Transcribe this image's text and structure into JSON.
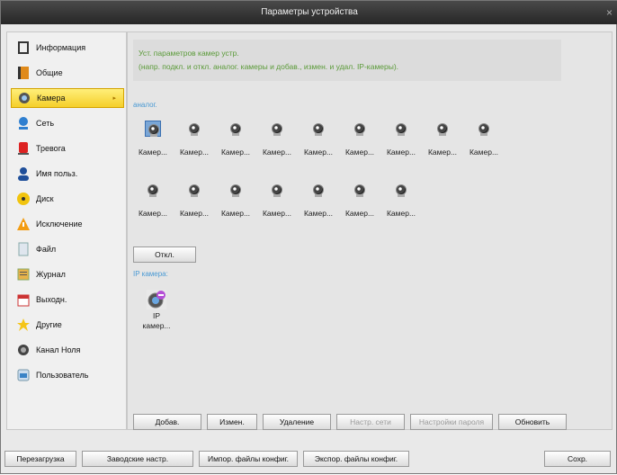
{
  "window": {
    "title": "Параметры устройства"
  },
  "sidebar": {
    "items": [
      {
        "label": "Информация",
        "icon": "info-icon"
      },
      {
        "label": "Общие",
        "icon": "book-icon"
      },
      {
        "label": "Камера",
        "icon": "camera-icon",
        "active": true
      },
      {
        "label": "Сеть",
        "icon": "network-icon"
      },
      {
        "label": "Тревога",
        "icon": "alarm-icon"
      },
      {
        "label": "Имя польз.",
        "icon": "user-icon"
      },
      {
        "label": "Диск",
        "icon": "disk-icon"
      },
      {
        "label": "Исключение",
        "icon": "warning-icon"
      },
      {
        "label": "Файл",
        "icon": "file-icon"
      },
      {
        "label": "Журнал",
        "icon": "log-icon"
      },
      {
        "label": "Выходн.",
        "icon": "holiday-icon"
      },
      {
        "label": "Другие",
        "icon": "star-icon"
      },
      {
        "label": "Канал Ноля",
        "icon": "zero-channel-icon"
      },
      {
        "label": "Пользователь",
        "icon": "custom-user-icon"
      }
    ]
  },
  "info": {
    "line1": "Уст. параметров камер устр.",
    "line2": "(напр. подкл. и откл. аналог. камеры и добав., измен. и удал. IP-камеры)."
  },
  "analog": {
    "label": "аналог.",
    "row1": [
      "Камер...",
      "Камер...",
      "Камер...",
      "Камер...",
      "Камер...",
      "Камер...",
      "Камер...",
      "Камер...",
      "Камер..."
    ],
    "row2": [
      "Камер...",
      "Камер...",
      "Камер...",
      "Камер...",
      "Камер...",
      "Камер...",
      "Камер..."
    ],
    "off_button": "Откл."
  },
  "ip": {
    "label": "IP камера:",
    "camera_label_line1": "IP",
    "camera_label_line2": "камер..."
  },
  "actions": {
    "add": "Добав.",
    "edit": "Измен.",
    "delete": "Удаление",
    "network": "Настр. сети",
    "password": "Настройки пароля",
    "refresh": "Обновить"
  },
  "bottom": {
    "reboot": "Перезагрузка",
    "factory": "Заводские настр.",
    "import": "Импор. файлы конфиг.",
    "export": "Экспор. файлы конфиг.",
    "save": "Сохр."
  },
  "colors": {
    "accent_active": "#f5cf2a",
    "info_text": "#5a9a38",
    "section_label": "#4a9ad4"
  }
}
